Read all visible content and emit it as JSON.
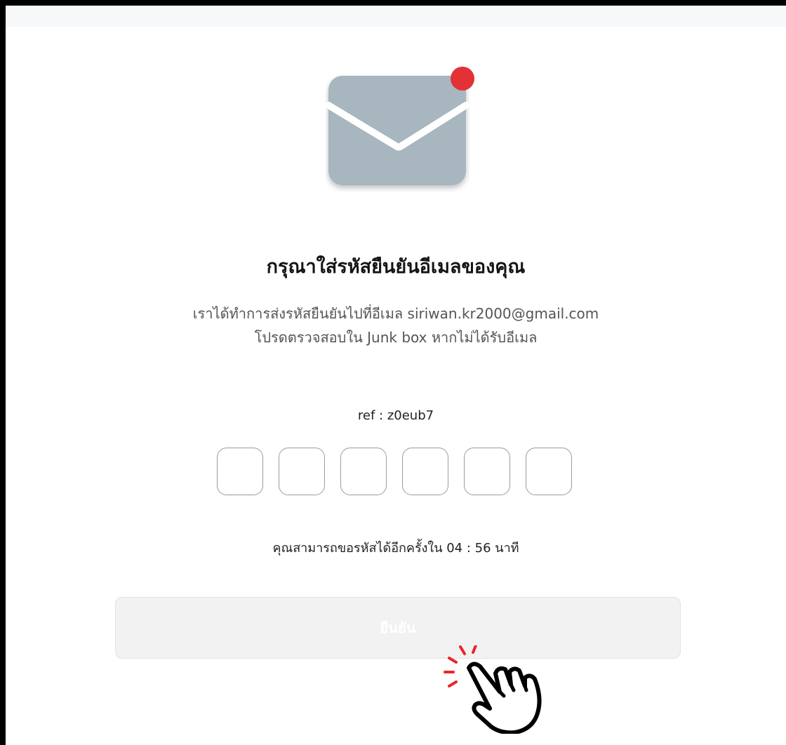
{
  "page": {
    "title": "กรุณาใส่รหัสยืนยันอีเมลของคุณ",
    "description_line1": "เราได้ทำการส่งรหัสยืนยันไปที่อีเมล siriwan.kr2000@gmail.com",
    "description_line2": "โปรดตรวจสอบใน Junk box หากไม่ได้รับอีเมล",
    "ref_label": "ref : z0eub7",
    "timer_text": "คุณสามารถขอรหัสได้อีกครั้งใน 04 : 56 นาที",
    "confirm_label": "ยืนยัน"
  },
  "otp": {
    "digits": [
      "",
      "",
      "",
      "",
      "",
      ""
    ]
  },
  "icons": {
    "envelope": "envelope-icon",
    "notification": "notification-dot-icon",
    "pointer": "hand-pointer-icon"
  },
  "colors": {
    "envelope": "#a7b6bf",
    "notification_dot": "#e23236",
    "button_bg": "#f2f2f2",
    "title_text": "#141414",
    "body_text": "#555555"
  }
}
